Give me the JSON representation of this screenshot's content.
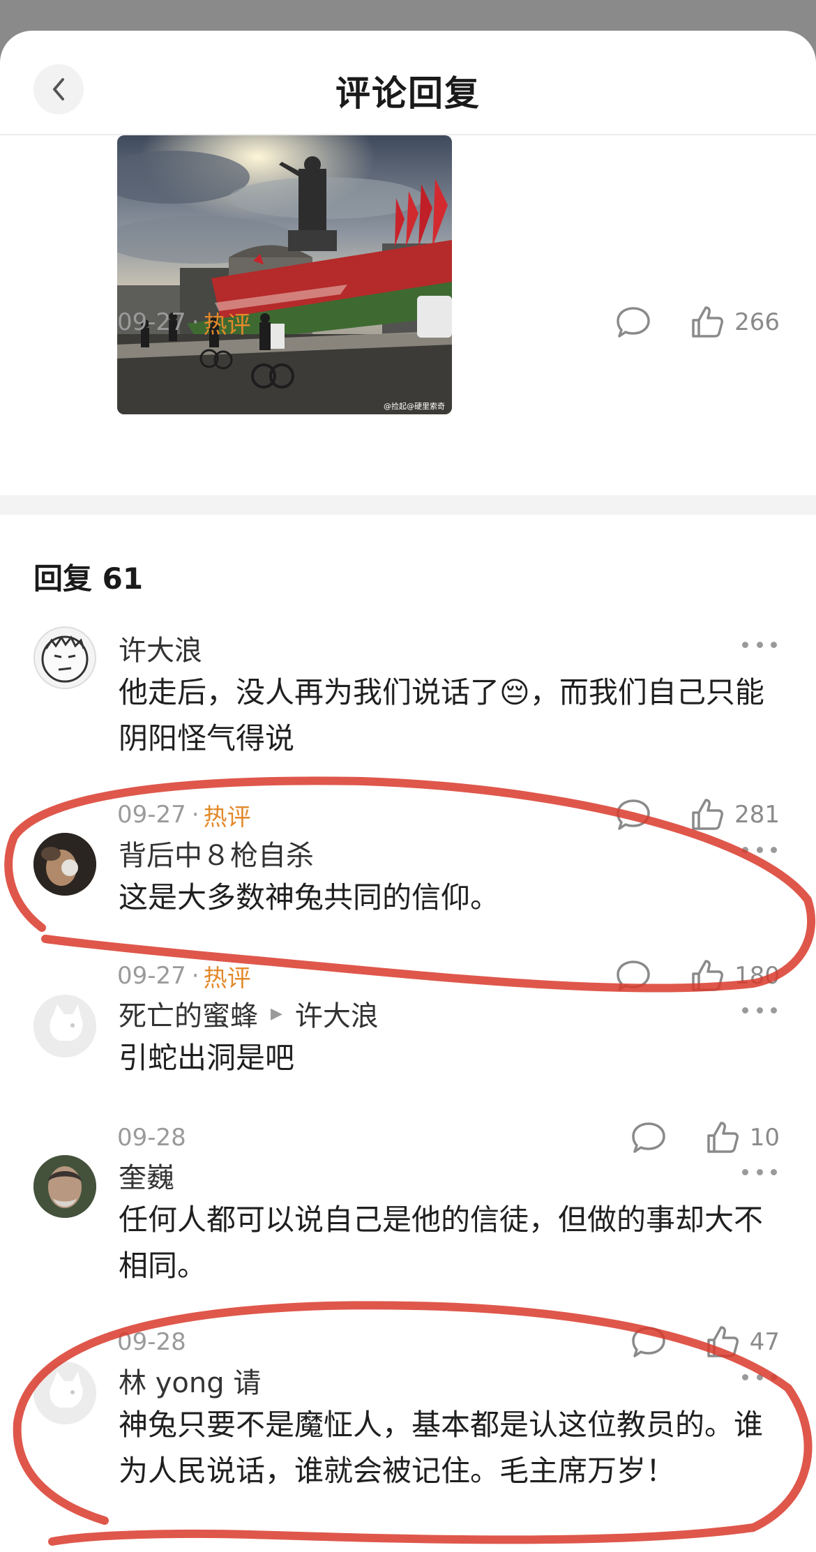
{
  "header": {
    "title": "评论回复",
    "back_icon": "chevron-left-icon"
  },
  "post": {
    "date": "09-27",
    "separator": "·",
    "hot_tag": "热评",
    "likes": "266",
    "image_watermark": "@捡起@硬里索奇"
  },
  "replies_heading": "回复 61",
  "comments": [
    {
      "username": "许大浪",
      "text_before": "他走后，没人再为我们说话了",
      "emoji": "😔",
      "text_after": "，而我们自己只能阴阳怪气得说",
      "date": "09-27",
      "separator": "·",
      "hot_tag": "热评",
      "likes": "281"
    },
    {
      "username": "背后中８枪自杀",
      "text": "这是大多数神兔共同的信仰。",
      "date": "09-27",
      "separator": "·",
      "hot_tag": "热评",
      "likes": "180"
    },
    {
      "username": "死亡的蜜蜂",
      "reply_to": "许大浪",
      "text": "引蛇出洞是吧",
      "date": "09-28",
      "likes": "10"
    },
    {
      "username": "奎巍",
      "text": "任何人都可以说自己是他的信徒，但做的事却大不相同。",
      "date": "09-28",
      "likes": "47"
    },
    {
      "username": "林 yong 请",
      "text": "神兔只要不是魔怔人，基本都是认这位教员的。谁为人民说话，谁就会被记住。毛主席万岁！"
    }
  ],
  "colors": {
    "hot": "#e3892b",
    "meta": "#9a9a9a",
    "annotation": "#d93a2b",
    "text": "#1f1f1f"
  }
}
